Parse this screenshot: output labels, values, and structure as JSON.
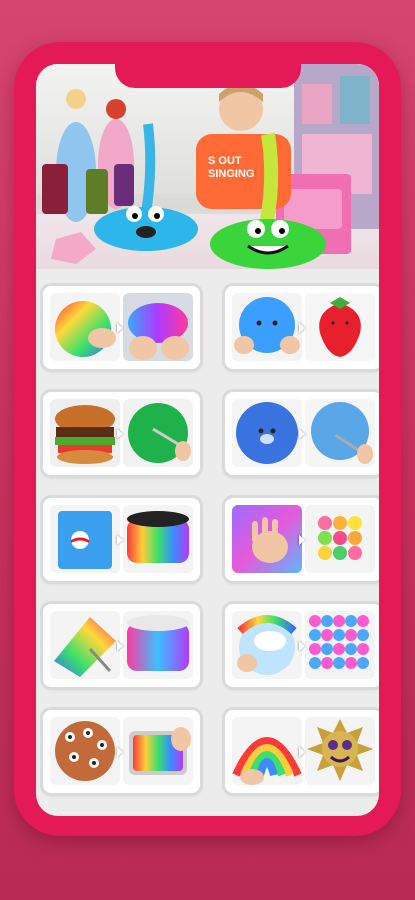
{
  "app": {
    "accent": "#e31a56",
    "background": "#d0406a"
  },
  "hero": {
    "shirt_text_line1": "S OUT",
    "shirt_text_line2": "SINGING"
  },
  "thumbnails": [
    {
      "a": "rainbow-apple-slime",
      "b": "galaxy-slime-stretch"
    },
    {
      "a": "blue-squishy-face",
      "b": "strawberry-squishy"
    },
    {
      "a": "burger-slime",
      "b": "green-balloon-slime"
    },
    {
      "a": "blue-bear-squishy",
      "b": "blue-balloon-cut"
    },
    {
      "a": "pepsi-slime-bag",
      "b": "rainbow-slime-tub"
    },
    {
      "a": "hand-print-slime",
      "b": "bubble-cube-squishy"
    },
    {
      "a": "rainbow-slime-cut",
      "b": "rainbow-slime-bowl"
    },
    {
      "a": "cloud-slime",
      "b": "pink-blue-bead-slime"
    },
    {
      "a": "cookie-monster-slime",
      "b": "rainbow-tray-slime"
    },
    {
      "a": "rainbow-glitter-slime",
      "b": "glitter-sun-face"
    }
  ]
}
